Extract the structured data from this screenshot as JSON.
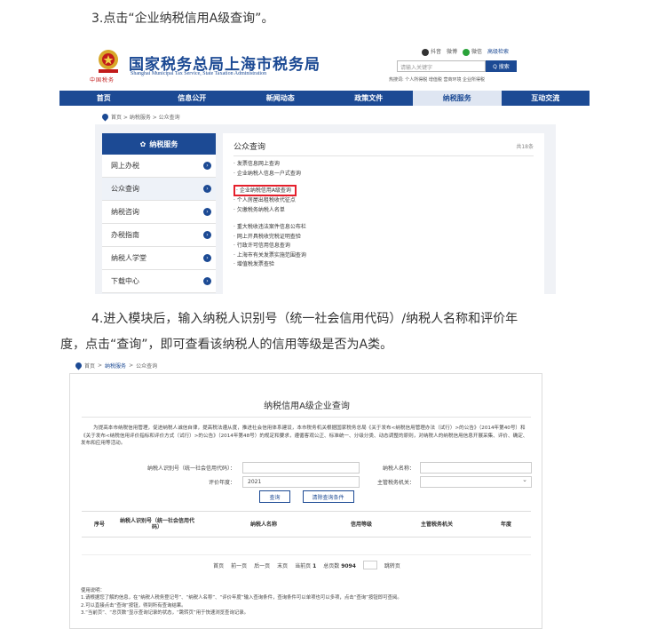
{
  "step3": "3.点击“企业纳税信用A级查询”。",
  "step4_line1": "4.进入模块后，输入纳税人识别号（统一社会信用代码）/纳税人名称和评价年",
  "step4_line2": "度，点击“查询”，即可查看该纳税人的信用等级是否为A类。",
  "shot1": {
    "site_title": "国家税务总局上海市税务局",
    "site_subtitle": "Shanghai Municipal Tax Service, State Taxation Administration",
    "emblem_caption": "中国税务",
    "toplinks": [
      "抖音",
      "微博",
      "微信",
      "高级检索"
    ],
    "search_placeholder": "请输入关键字",
    "search_button": "Q 搜索",
    "hotwords": "热搜词: 个人所得税  增值税  营商环境  企业所得税",
    "nav": [
      "首页",
      "信息公开",
      "新闻动态",
      "政策文件",
      "纳税服务",
      "互动交流"
    ],
    "breadcrumb": "首页 > 纳税服务 > 公众查询",
    "sidebar_title": "纳税服务",
    "sidebar": [
      "网上办税",
      "公众查询",
      "纳税咨询",
      "办税指南",
      "纳税人学堂",
      "下载中心"
    ],
    "content_title": "公众查询",
    "content_count": "共18条",
    "links_group1": [
      "发票信息网上查询",
      "企业纳税人信息一户式查询",
      "企业纳税信用A级查询",
      "个人房屋出租税收代征点",
      "欠缴税务纳税人名单"
    ],
    "links_group2": [
      "重大税收违法案件信息公布栏",
      "网上开具税收完税证明查验",
      "行政许可信用信息查询",
      "上海市有关发票实施范围查询",
      "增值税发票查验"
    ]
  },
  "shot2": {
    "breadcrumb_home": "首页",
    "breadcrumb_mid": "纳税服务",
    "breadcrumb_tail": "公众查询",
    "title": "纳税信用A级企业查询",
    "intro": "为提高本市纳税信用管理，促进纳税人诚信自律，提高税法遵从度，推进社会信用体系建设，本市税务机关根据国家税务总局《关于发布<纳税信用管理办法（试行）>的公告》（2014年第40号）和《关于发布<纳税信用评价指标和评价方式（试行）>的公告》（2014年第48号）的规定和要求，遵循客观公正、标准统一、分级分类、动态调整的原则，对纳税人的纳税信用信息开展采集、评价、确定、发布和应用等活动。",
    "label_id": "纳税人识别号（统一社会信用代码）：",
    "label_name": "纳税人名称：",
    "label_year": "评价年度：",
    "year_value": "2021",
    "label_office": "主管税务机关：",
    "btn_query": "查询",
    "btn_clear": "清除查询条件",
    "table_headers": [
      "序号",
      "纳税人识别号（统一社会信用代码）",
      "纳税人名称",
      "信用等级",
      "主管税务机关",
      "年度"
    ],
    "pager": {
      "first": "首页",
      "prev": "前一页",
      "next": "后一页",
      "last": "末页",
      "current_label": "当前页",
      "current": "1",
      "total_label": "总页数",
      "total": "9094",
      "jump": "跳转页"
    },
    "notes_title": "使用说明：",
    "notes": [
      "1.请根据您了解的信息，在“纳税人税务登记号”、“纳税人名称”、“评价年度”输入查询条件，查询条件可以单项也可以多项，点击“查询”按钮即可查阅。",
      "2.可以直接点击“查询”按钮，得到所有查询结果。",
      "3.“当前页”、“总页数”显示查询记录的状态，“跳转页”用于快速浏览查询记录。"
    ]
  }
}
